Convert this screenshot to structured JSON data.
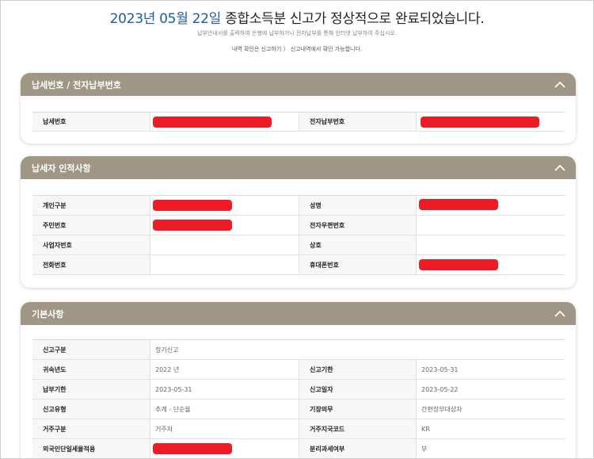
{
  "header": {
    "title_date": "2023년 05월 22일",
    "title_rest": " 종합소득분 신고가 정상적으로 완료되었습니다.",
    "subtitle": "납부안내서를 출력하여 은행에 납부하거나 전자납부를 통해 인터넷 납부하여 주십시오.",
    "subtitle2": "내역 확인은 신고하기 〉 신고내역에서 확인 가능합니다."
  },
  "colors": {
    "accent_blue": "#1e5aa8",
    "section_header": "#a09686",
    "redaction": "#ee1c24"
  },
  "sections": [
    {
      "title": "납세번호 / 전자납부번호",
      "rows": [
        {
          "l1": "납세번호",
          "v1": "",
          "l2": "전자납부번호",
          "v2": ""
        }
      ]
    },
    {
      "title": "납세자 인적사항",
      "rows": [
        {
          "l1": "개인구분",
          "v1": "",
          "l2": "성명",
          "v2": ""
        },
        {
          "l1": "주민번호",
          "v1": "",
          "l2": "전자우편번호",
          "v2": ""
        },
        {
          "l1": "사업자번호",
          "v1": "",
          "l2": "상호",
          "v2": ""
        },
        {
          "l1": "전화번호",
          "v1": "",
          "l2": "휴대폰번호",
          "v2": ""
        }
      ]
    },
    {
      "title": "기본사항",
      "rows": [
        {
          "l1": "신고구분",
          "v1": "정기신고"
        },
        {
          "l1": "귀속년도",
          "v1": "2022 년",
          "l2": "신고기한",
          "v2": "2023-05-31"
        },
        {
          "l1": "납부기한",
          "v1": "2023-05-31",
          "l2": "신고일자",
          "v2": "2023-05-22"
        },
        {
          "l1": "신고유형",
          "v1": "추계 - 단순율",
          "l2": "기장의무",
          "v2": "간편장부대상자"
        },
        {
          "l1": "거주구분",
          "v1": "거주자",
          "l2": "거주지국코드",
          "v2": "KR"
        },
        {
          "l1": "외국인단일세율적용",
          "v1": "",
          "l2": "분리과세여부",
          "v2": "부"
        }
      ]
    }
  ]
}
